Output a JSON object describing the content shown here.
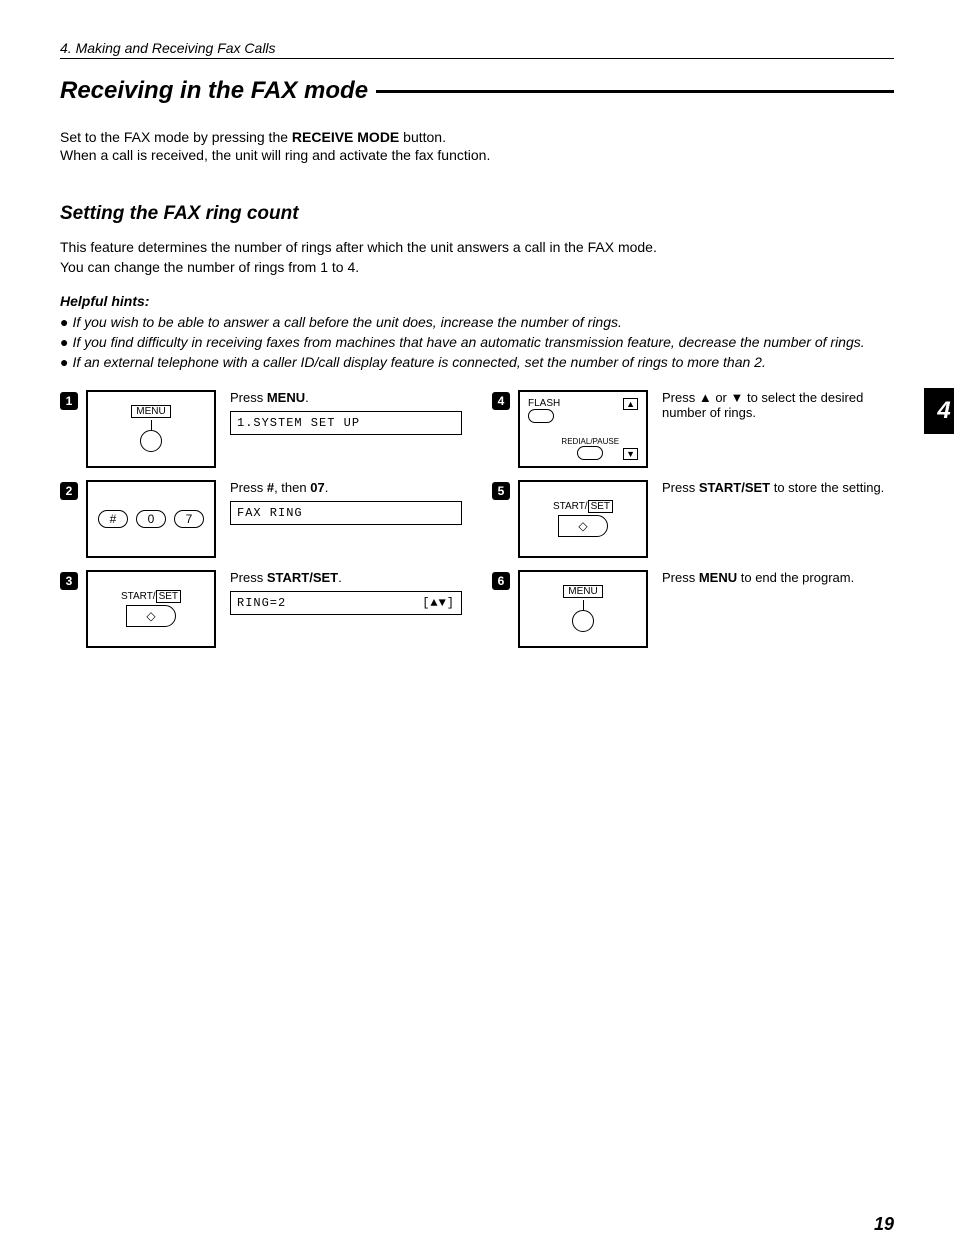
{
  "header": "4.  Making and Receiving Fax Calls",
  "mainTitle": "Receiving in the FAX mode",
  "intro1a": "Set to the FAX mode by pressing the ",
  "intro1b": "RECEIVE MODE",
  "intro1c": " button.",
  "intro2": "When a call is received, the unit will ring and activate the fax function.",
  "subTitle": "Setting the FAX ring count",
  "para1": "This feature determines the number of rings after which the unit answers a call in the FAX mode.",
  "para2": "You can change the number of rings from 1 to 4.",
  "hintsHeading": "Helpful hints:",
  "hint1": "If you wish to be able to answer a call before the unit does, increase the number of rings.",
  "hint2": "If you find difficulty in receiving faxes from machines that have an automatic transmission feature, decrease the number of rings.",
  "hint3": "If an external telephone with a caller ID/call display feature is connected, set the number of rings to more than 2.",
  "steps": {
    "s1": {
      "num": "1",
      "instrA": "Press ",
      "instrB": "MENU",
      "instrC": ".",
      "display": "1.SYSTEM SET UP",
      "menuLabel": "MENU"
    },
    "s2": {
      "num": "2",
      "instrA": "Press ",
      "instrB": "#",
      "instrC": ", then ",
      "instrD": "07",
      "instrE": ".",
      "display": "FAX RING",
      "keys": [
        "#",
        "0",
        "7"
      ]
    },
    "s3": {
      "num": "3",
      "instrA": "Press ",
      "instrB": "START/SET",
      "instrC": ".",
      "displayL": "RING=2",
      "displayR": "[▲▼]",
      "labelA": "START/",
      "labelB": "SET",
      "diamond": "◇"
    },
    "s4": {
      "num": "4",
      "instr": "Press ▲ or ▼ to select the desired number of rings.",
      "flash": "FLASH",
      "redial": "REDIAL/PAUSE",
      "up": "▲",
      "down": "▼"
    },
    "s5": {
      "num": "5",
      "instrA": "Press ",
      "instrB": "START/SET",
      "instrC": " to store the setting.",
      "labelA": "START/",
      "labelB": "SET",
      "diamond": "◇"
    },
    "s6": {
      "num": "6",
      "instrA": "Press ",
      "instrB": "MENU",
      "instrC": " to end the program.",
      "menuLabel": "MENU"
    }
  },
  "tab": "4",
  "pageNum": "19"
}
